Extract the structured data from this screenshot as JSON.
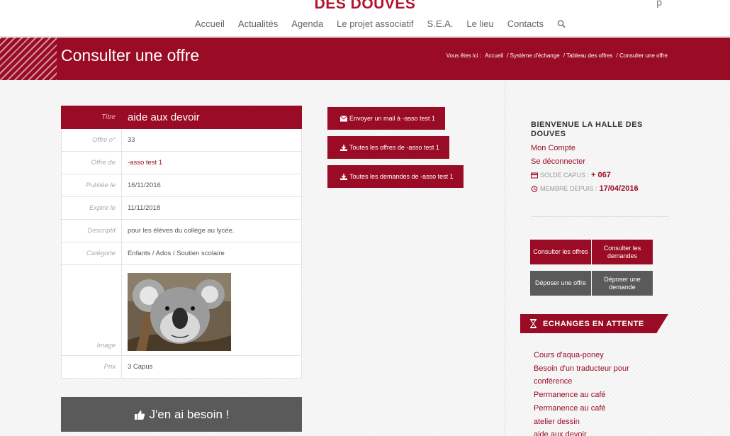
{
  "header": {
    "logo_text": "DES DOUVES",
    "logo_right": "p",
    "nav": [
      "Accueil",
      "Actualités",
      "Agenda",
      "Le projet associatif",
      "S.E.A.",
      "Le lieu",
      "Contacts"
    ]
  },
  "band": {
    "title": "Consulter une offre",
    "breadcrumb_prefix": "Vous êtes ici :",
    "breadcrumb": [
      "Accueil",
      "/ Système d'échange",
      "/ Tableau des offres",
      "/ Consulter une offre"
    ]
  },
  "offer": {
    "title_label": "Titre",
    "title_value": "aide aux devoir",
    "rows": [
      {
        "label": "Offre n°",
        "value": "33"
      },
      {
        "label": "Offre de",
        "value": "-asso test 1"
      },
      {
        "label": "Publiée le",
        "value": "16/11/2016"
      },
      {
        "label": "Expire le",
        "value": "11/11/2018"
      },
      {
        "label": "Descriptif",
        "value": "pour les élèves du collège au lycée."
      },
      {
        "label": "Catégorie",
        "value": "Enfants / Ados / Soutien scolaire"
      }
    ],
    "image_label": "Image",
    "price_label": "Prix",
    "price_value": "3 Capus",
    "need_button": "J'en ai besoin !"
  },
  "actions": {
    "mail": "Envoyer un mail à -asso test 1",
    "all_offers": "Toutes les offres de -asso test 1",
    "all_requests": "Toutes les demandes de -asso test 1"
  },
  "sidebar": {
    "welcome": "BIENVENUE LA HALLE DES DOUVES",
    "account": "Mon Compte",
    "logout": "Se déconnecter",
    "balance_label": "SOLDE CAPUS :",
    "balance_value": "+ 067",
    "member_label": "MEMBRE DEPUIS :",
    "member_value": "17/04/2016",
    "btn_offers": "Consulter les offres",
    "btn_requests": "Consulter les demandes",
    "btn_post_offer": "Déposer une offre",
    "btn_post_request": "Déposer une demande",
    "pending_title": "ECHANGES EN ATTENTE",
    "pending": [
      "Cours d'aqua-poney",
      "Besoin d'un traducteur pour",
      "conférence",
      "Permanence au café",
      "Permanence au café",
      "atelier dessin",
      "aide aux devoir"
    ]
  },
  "colors": {
    "brand": "#9a0c25",
    "dark_button": "#5a5a5a"
  }
}
